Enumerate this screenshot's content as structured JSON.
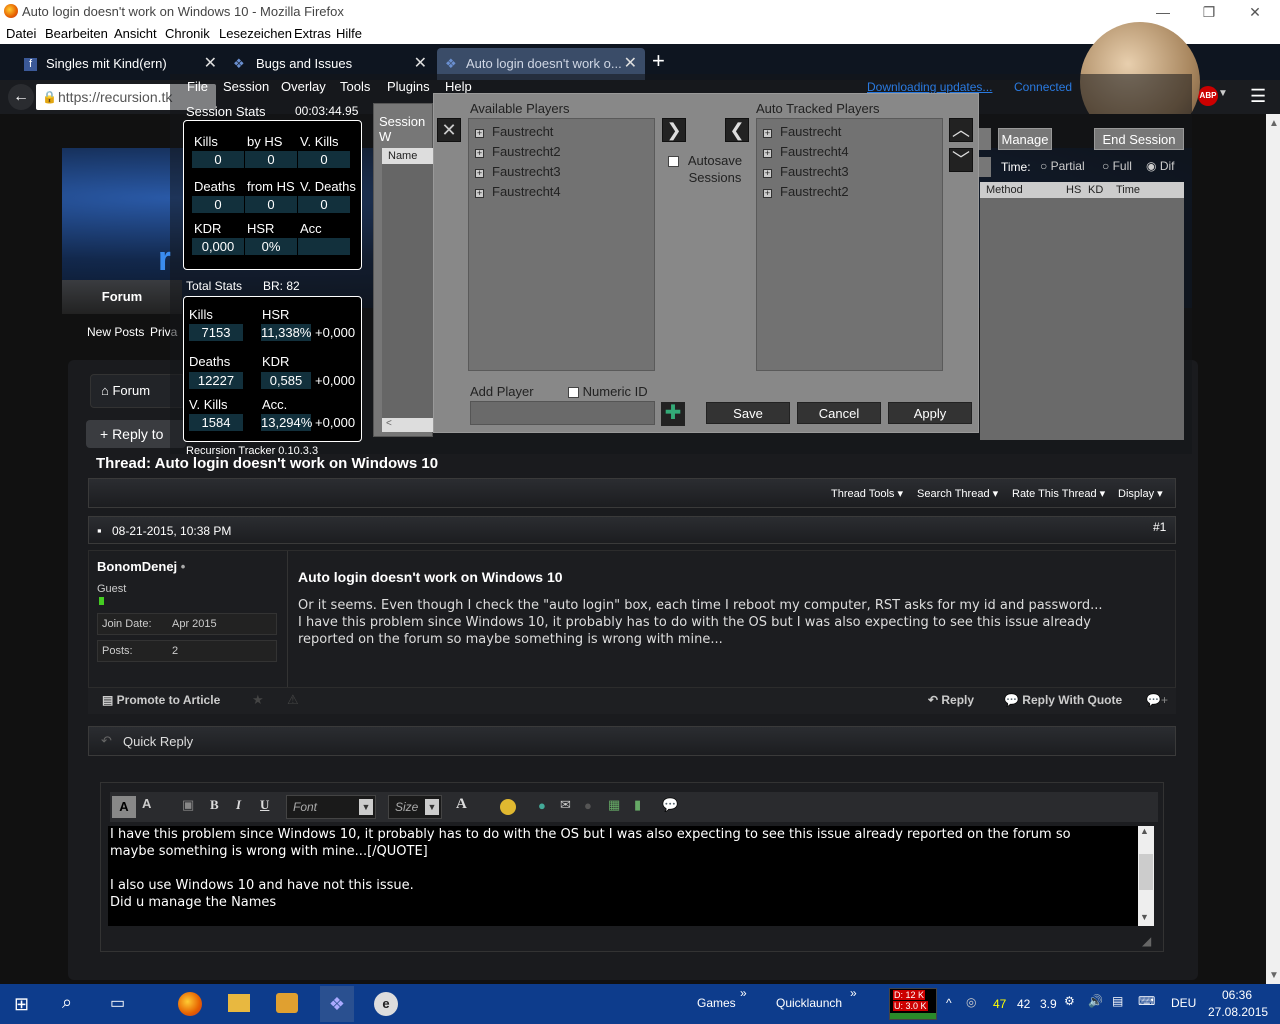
{
  "window": {
    "title": "Auto login doesn't work on Windows 10 - Mozilla Firefox"
  },
  "menubar": [
    "Datei",
    "Bearbeiten",
    "Ansicht",
    "Chronik",
    "Lesezeichen",
    "Extras",
    "Hilfe"
  ],
  "tabs": [
    {
      "label": "Singles mit Kind(ern)"
    },
    {
      "label": "Bugs and Issues"
    },
    {
      "label": "Auto login doesn't work o..."
    }
  ],
  "url": "https://recursion.tk",
  "abp_label": "ABP",
  "overlay": {
    "menu": [
      "File",
      "Session",
      "Overlay",
      "Tools",
      "Plugins",
      "Help"
    ],
    "status": {
      "updating": "Downloading updates...",
      "connection": "Connected"
    },
    "session_stats": {
      "label": "Session Stats",
      "timer": "00:03:44.95"
    },
    "session": {
      "row1": {
        "labels": [
          "Kills",
          "by HS",
          "V. Kills"
        ],
        "values": [
          "0",
          "0",
          "0"
        ]
      },
      "row2": {
        "labels": [
          "Deaths",
          "from HS",
          "V. Deaths"
        ],
        "values": [
          "0",
          "0",
          "0"
        ]
      },
      "row3": {
        "labels": [
          "KDR",
          "HSR",
          "Acc"
        ],
        "values": [
          "0,000",
          "0%",
          ""
        ]
      }
    },
    "total": {
      "label": "Total Stats",
      "br": "BR: 82",
      "kills_label": "Kills",
      "kills": "7153",
      "hsr_label": "HSR",
      "hsr": "11,338%",
      "hsr_delta": "+0,000",
      "deaths_label": "Deaths",
      "deaths": "12227",
      "kdr_label": "KDR",
      "kdr": "0,585",
      "kdr_delta": "+0,000",
      "vkills_label": "V. Kills",
      "vkills": "1584",
      "acc_label": "Acc.",
      "acc": "13,294%",
      "acc_delta": "+0,000"
    },
    "version": "Recursion Tracker 0.10.3.3",
    "session_window_label": "Session W",
    "name_col": "Name",
    "manage": "Manage",
    "end_session": "End Session",
    "time_label": "Time:",
    "time_options": [
      "Partial",
      "Full",
      "Dif"
    ],
    "columns": [
      "Method",
      "HS",
      "KD",
      "Time"
    ]
  },
  "dialog": {
    "available_title": "Available Players",
    "available": [
      "Faustrecht",
      "Faustrecht2",
      "Faustrecht3",
      "Faustrecht4"
    ],
    "tracked_title": "Auto Tracked Players",
    "tracked": [
      "Faustrecht",
      "Faustrecht4",
      "Faustrecht3",
      "Faustrecht2"
    ],
    "autosave": "Autosave Sessions",
    "add_player": "Add Player",
    "numeric_id": "Numeric ID",
    "add_input": "",
    "save": "Save",
    "cancel": "Cancel",
    "apply": "Apply"
  },
  "forum": {
    "nav_forum": "Forum",
    "new_posts": "New Posts",
    "priva": "Priva",
    "breadcrumb_forum": "Forum",
    "reply_btn": "+ Reply to",
    "thread_title": "Thread: Auto login doesn't work on Windows 10",
    "tools": [
      "Thread Tools",
      "Search Thread",
      "Rate This Thread",
      "Display"
    ],
    "post": {
      "date": "08-21-2015, 10:38 PM",
      "number": "#1",
      "author": "BonomDenej",
      "role": "Guest",
      "join_label": "Join Date:",
      "join": "Apr 2015",
      "posts_label": "Posts:",
      "posts": "2",
      "title": "Auto login doesn't work on Windows 10",
      "body": [
        "Or it seems. Even though I check the \"auto login\" box, each time I reboot my computer, RST asks for my id and password...",
        "I have this problem since Windows 10, it probably has to do with the OS but I was also expecting to see this issue already",
        "reported on the forum so maybe something is wrong with mine..."
      ],
      "promote": "Promote to Article",
      "reply": "Reply",
      "reply_quote": "Reply With Quote"
    },
    "quick_reply": "Quick Reply",
    "font_select": "Font",
    "size_select": "Size",
    "editor_lines": [
      "I have this problem since Windows 10, it probably has to do with the OS but I was also expecting to see this issue already reported on the forum so",
      "maybe something is wrong with mine...[/QUOTE]",
      "",
      "I also use Windows 10 and have not this issue.",
      "Did u manage the Names"
    ]
  },
  "taskbar": {
    "games": "Games",
    "quicklaunch": "Quicklaunch",
    "net_down": "D: 12 K",
    "net_up": "U: 3.0 K",
    "tray_nums": [
      "47",
      "42",
      "3.9"
    ],
    "lang": "DEU",
    "time": "06:36",
    "date": "27.08.2015"
  }
}
